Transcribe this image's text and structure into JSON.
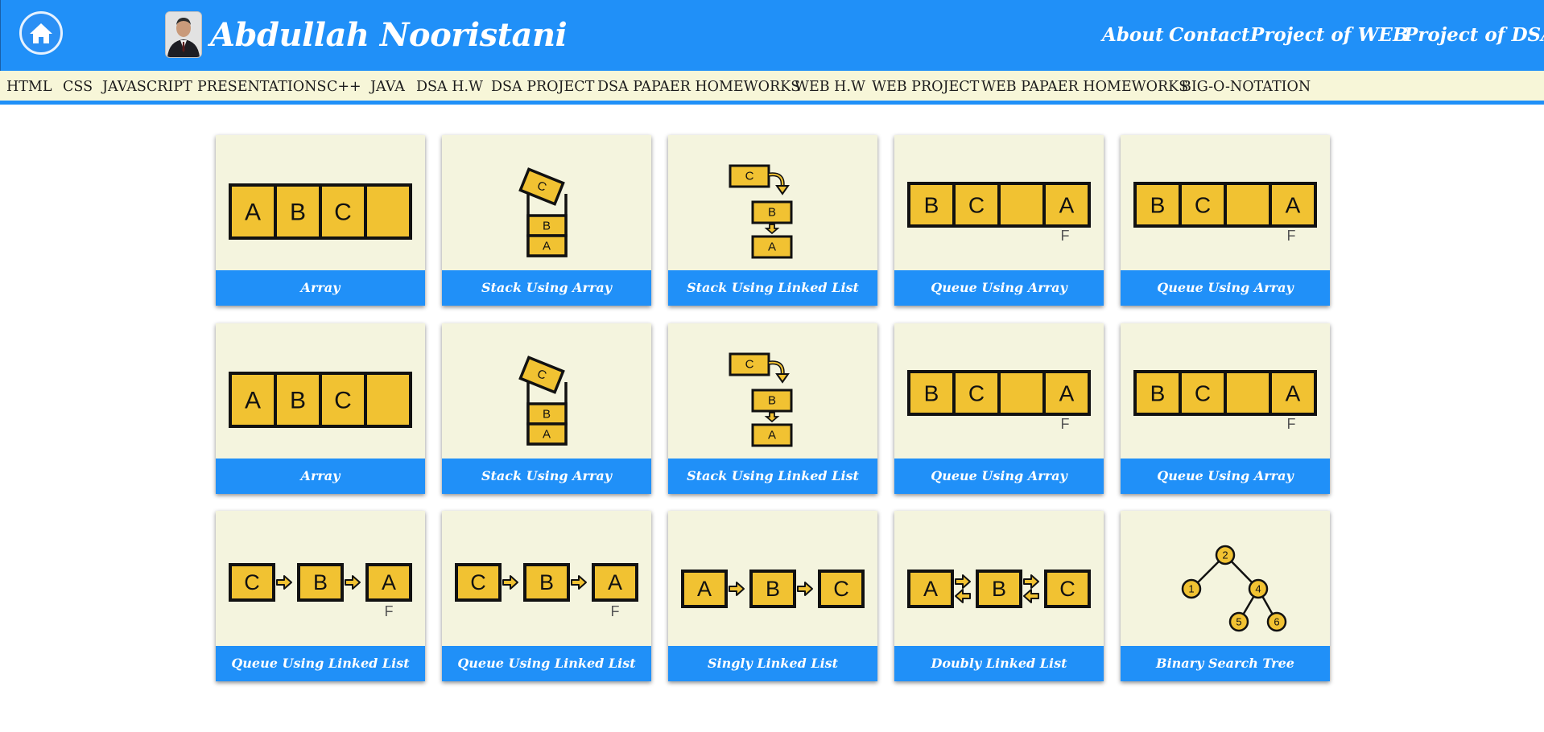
{
  "colors": {
    "header_bg": "#2090f8",
    "subnav_bg": "#f7f6d8",
    "card_bg": "#f4f4de",
    "box_fill": "#f1c232",
    "box_stroke": "#111111",
    "caption_bg": "#2090f8"
  },
  "header": {
    "home_icon": "home-icon",
    "author_name": "Abdullah Nooristani",
    "nav": [
      "About",
      "Contact",
      "Project of WEB",
      "Project of DSA"
    ]
  },
  "subnav": {
    "items": [
      "HTML",
      "CSS",
      "JAVASCRIPT",
      "PRESENTATIONS",
      "C++",
      "JAVA",
      "DSA H.W",
      "DSA PROJECT",
      "DSA PAPAER HOMEWORKS",
      "WEB H.W",
      "WEB PROJECT",
      "WEB PAPAER HOMEWORKS",
      "BIG-O-NOTATION"
    ]
  },
  "cards": [
    {
      "title": "Array",
      "diagram": "array",
      "labels": [
        "A",
        "B",
        "C"
      ]
    },
    {
      "title": "Stack Using Array",
      "diagram": "stack-array",
      "labels": [
        "C",
        "B",
        "A"
      ]
    },
    {
      "title": "Stack Using Linked List",
      "diagram": "stack-linked",
      "labels": [
        "C",
        "B",
        "A"
      ]
    },
    {
      "title": "Queue Using Array",
      "diagram": "queue-array",
      "labels": [
        "B",
        "C",
        "A"
      ],
      "marker": "F"
    },
    {
      "title": "Queue Using Array",
      "diagram": "queue-array",
      "labels": [
        "B",
        "C",
        "A"
      ],
      "marker": "F"
    },
    {
      "title": "Array",
      "diagram": "array",
      "labels": [
        "A",
        "B",
        "C"
      ]
    },
    {
      "title": "Stack Using Array",
      "diagram": "stack-array",
      "labels": [
        "C",
        "B",
        "A"
      ]
    },
    {
      "title": "Stack Using Linked List",
      "diagram": "stack-linked",
      "labels": [
        "C",
        "B",
        "A"
      ]
    },
    {
      "title": "Queue Using Array",
      "diagram": "queue-array",
      "labels": [
        "B",
        "C",
        "A"
      ],
      "marker": "F"
    },
    {
      "title": "Queue Using Array",
      "diagram": "queue-array",
      "labels": [
        "B",
        "C",
        "A"
      ],
      "marker": "F"
    },
    {
      "title": "Queue Using Linked List",
      "diagram": "queue-linked",
      "labels": [
        "C",
        "B",
        "A"
      ],
      "marker": "F"
    },
    {
      "title": "Queue Using Linked List",
      "diagram": "queue-linked",
      "labels": [
        "C",
        "B",
        "A"
      ],
      "marker": "F"
    },
    {
      "title": "Singly Linked List",
      "diagram": "singly-linked",
      "labels": [
        "A",
        "B",
        "C"
      ]
    },
    {
      "title": "Doubly Linked List",
      "diagram": "doubly-linked",
      "labels": [
        "A",
        "B",
        "C"
      ]
    },
    {
      "title": "Binary Search Tree",
      "diagram": "bst",
      "labels": [
        "2",
        "1",
        "4",
        "5",
        "6"
      ]
    }
  ]
}
